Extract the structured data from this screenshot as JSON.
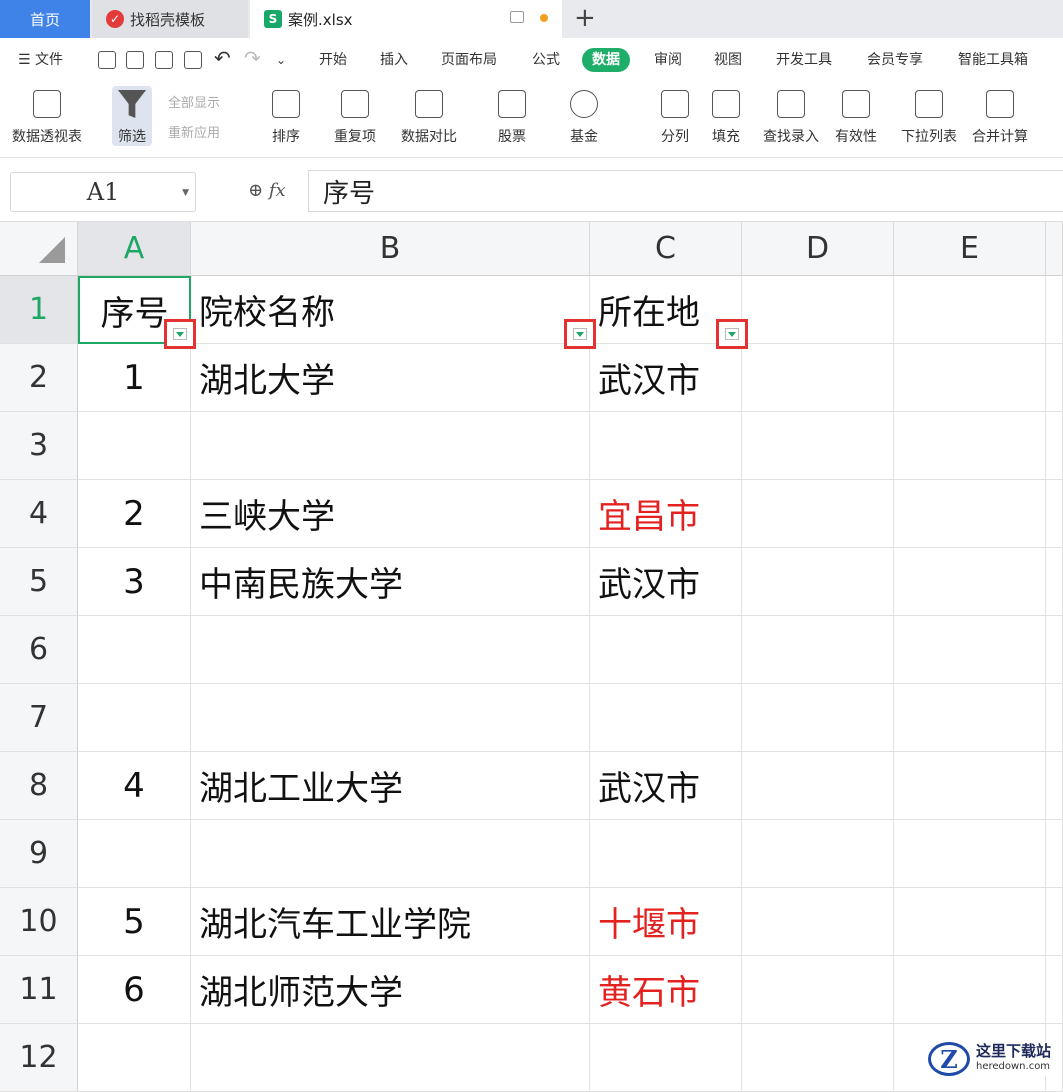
{
  "tabs": {
    "home": "首页",
    "daoke": "找稻壳模板",
    "file": "案例.xlsx"
  },
  "menu": [
    "文件",
    "开始",
    "插入",
    "页面布局",
    "公式",
    "数据",
    "审阅",
    "视图",
    "开发工具",
    "会员专享",
    "智能工具箱"
  ],
  "ribbon": {
    "pivot": "数据透视表",
    "filter": "筛选",
    "show_all": "全部显示",
    "reapply": "重新应用",
    "sort": "排序",
    "dup": "重复项",
    "compare": "数据对比",
    "stock": "股票",
    "fund": "基金",
    "split": "分列",
    "fill": "填充",
    "lookup": "查找录入",
    "validity": "有效性",
    "dropdown": "下拉列表",
    "merge_calc": "合并计算"
  },
  "formula_bar": {
    "name_box": "A1",
    "fx": "fx",
    "content": "序号"
  },
  "columns": [
    "A",
    "B",
    "C",
    "D",
    "E"
  ],
  "rows": [
    "1",
    "2",
    "3",
    "4",
    "5",
    "6",
    "7",
    "8",
    "9",
    "10",
    "11",
    "12"
  ],
  "cells": {
    "r1": {
      "a": "序号",
      "b": "院校名称",
      "c": "所在地"
    },
    "r2": {
      "a": "1",
      "b": "湖北大学",
      "c": "武汉市"
    },
    "r4": {
      "a": "2",
      "b": "三峡大学",
      "c": "宜昌市"
    },
    "r5": {
      "a": "3",
      "b": "中南民族大学",
      "c": "武汉市"
    },
    "r8": {
      "a": "4",
      "b": "湖北工业大学",
      "c": "武汉市"
    },
    "r10": {
      "a": "5",
      "b": "湖北汽车工业学院",
      "c": "十堰市"
    },
    "r11": {
      "a": "6",
      "b": "湖北师范大学",
      "c": "黄石市"
    }
  },
  "watermark": {
    "name": "这里下载站",
    "url": "heredown.com"
  },
  "colors": {
    "accent": "#1fa765",
    "highlight": "#e3211f",
    "tab_blue": "#3f83e8"
  }
}
